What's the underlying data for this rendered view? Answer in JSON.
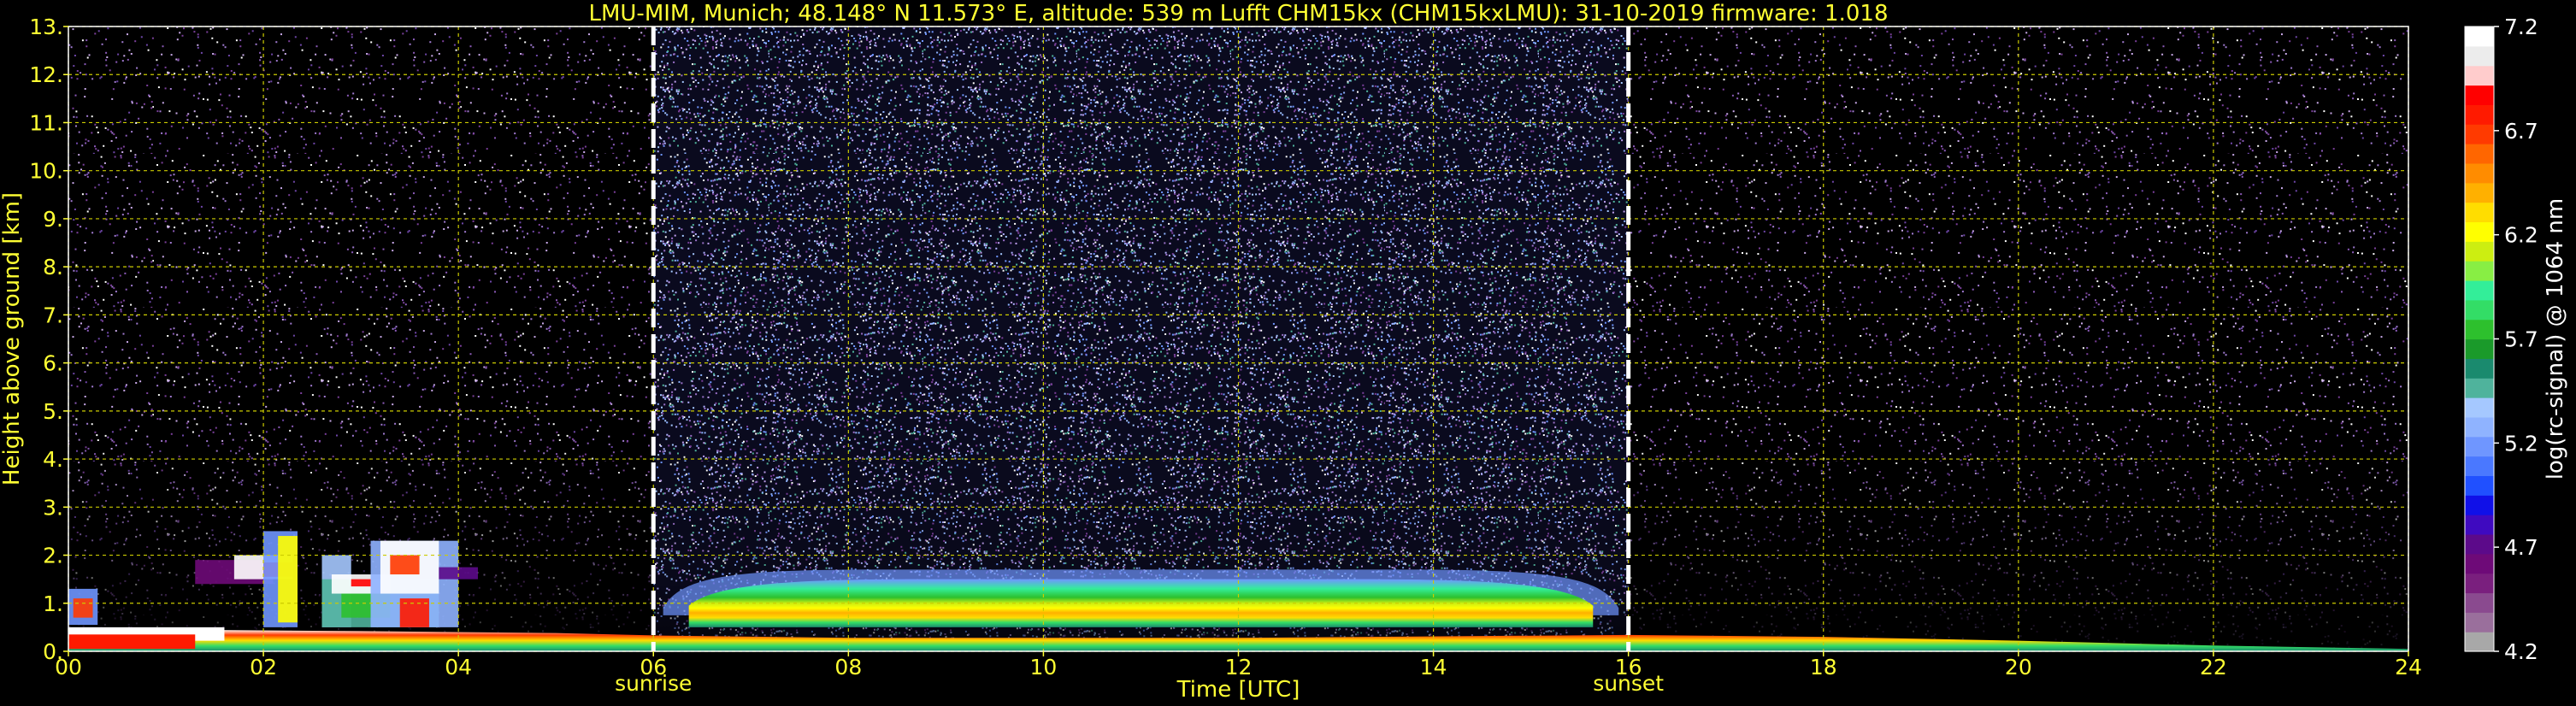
{
  "chart_data": {
    "type": "heatmap",
    "title": "LMU-MIM, Munich; 48.148° N 11.573° E, altitude: 539 m    Lufft CHM15kx (CHM15kxLMU): 31-10-2019    firmware: 1.018",
    "xlabel": "Time [UTC]",
    "ylabel": "Height above ground [km]",
    "xlim": [
      0,
      24
    ],
    "ylim": [
      0,
      13
    ],
    "x_ticks": [
      "00",
      "02",
      "04",
      "06",
      "08",
      "10",
      "12",
      "14",
      "16",
      "18",
      "20",
      "22",
      "24"
    ],
    "y_ticks": [
      "0.",
      "1.",
      "2.",
      "3.",
      "4.",
      "5.",
      "6.",
      "7.",
      "8.",
      "9.",
      "10.",
      "11.",
      "12.",
      "13."
    ],
    "grid": true,
    "markers": [
      {
        "x": 6.0,
        "label": "sunrise"
      },
      {
        "x": 16.0,
        "label": "sunset"
      }
    ],
    "colorbar": {
      "label": "log(rc-signal) @ 1064 nm",
      "range": [
        4.2,
        7.2
      ],
      "ticks": [
        "4.2",
        "4.7",
        "5.2",
        "5.7",
        "6.2",
        "6.7",
        "7.2"
      ],
      "colors": [
        "#a8a8a8",
        "#9a6f9c",
        "#8a4a8f",
        "#7a1f7e",
        "#6e0a78",
        "#5c0a8a",
        "#3f0ac0",
        "#1010e8",
        "#2050ff",
        "#4a78ff",
        "#6f96ff",
        "#8fb3ff",
        "#a5c8ff",
        "#4fb39c",
        "#1a8a6e",
        "#1a9a2a",
        "#2dc02d",
        "#33dd66",
        "#33ee99",
        "#88ee44",
        "#ccee11",
        "#ffff00",
        "#ffdd00",
        "#ffb000",
        "#ff8c00",
        "#ff6600",
        "#ff3a00",
        "#ff1a00",
        "#ff0000",
        "#ffcccc",
        "#ececec",
        "#ffffff"
      ]
    },
    "features": [
      {
        "name": "surface aerosol layer",
        "x": [
          0,
          24
        ],
        "y": [
          0.0,
          0.4
        ]
      },
      {
        "name": "boundary layer aerosol",
        "x": [
          6.1,
          15.9
        ],
        "y": [
          0.5,
          1.7
        ]
      },
      {
        "name": "low clouds",
        "x": [
          0,
          4.2
        ],
        "y": [
          0.5,
          2.6
        ]
      }
    ]
  }
}
